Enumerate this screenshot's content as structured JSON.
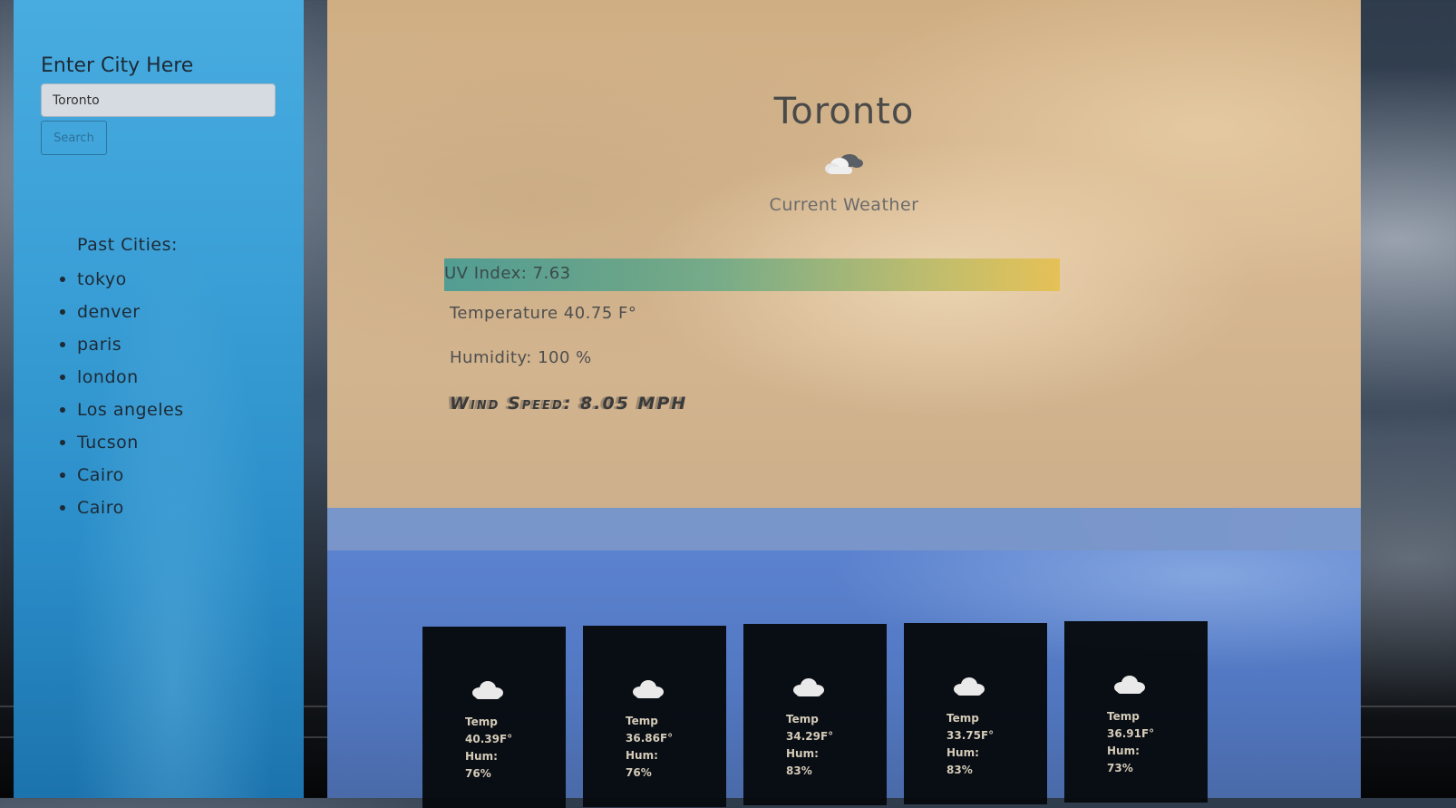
{
  "sidebar": {
    "city_label": "Enter City Here",
    "city_input_value": "Toronto",
    "search_label": "Search",
    "past_title": "Past Cities:",
    "past_cities": [
      "tokyo",
      "denver",
      "paris",
      "london",
      "Los angeles",
      "Tucson",
      "Cairo",
      "Cairo"
    ]
  },
  "current": {
    "city": "Toronto",
    "icon": "cloud-icon",
    "subtitle": "Current Weather",
    "uv": "UV Index: 7.63",
    "temperature": "Temperature 40.75 F°",
    "humidity": "Humidity: 100 %",
    "wind": "Wind Speed: 8.05 MPH"
  },
  "forecast": {
    "days": [
      {
        "icon": "cloud-icon",
        "temp_label": "Temp",
        "temp": "40.39F°",
        "hum_label": "Hum:",
        "hum": "76%"
      },
      {
        "icon": "cloud-icon",
        "temp_label": "Temp",
        "temp": "36.86F°",
        "hum_label": "Hum:",
        "hum": "76%"
      },
      {
        "icon": "cloud-icon",
        "temp_label": "Temp",
        "temp": "34.29F°",
        "hum_label": "Hum:",
        "hum": "83%"
      },
      {
        "icon": "cloud-icon",
        "temp_label": "Temp",
        "temp": "33.75F°",
        "hum_label": "Hum:",
        "hum": "83%"
      },
      {
        "icon": "cloud-icon",
        "temp_label": "Temp",
        "temp": "36.91F°",
        "hum_label": "Hum:",
        "hum": "73%"
      }
    ]
  },
  "colors": {
    "sidebar": "#3a9fd6",
    "current_panel": "#d7b892",
    "forecast_panel": "#5278c2",
    "card": "#06090e"
  }
}
